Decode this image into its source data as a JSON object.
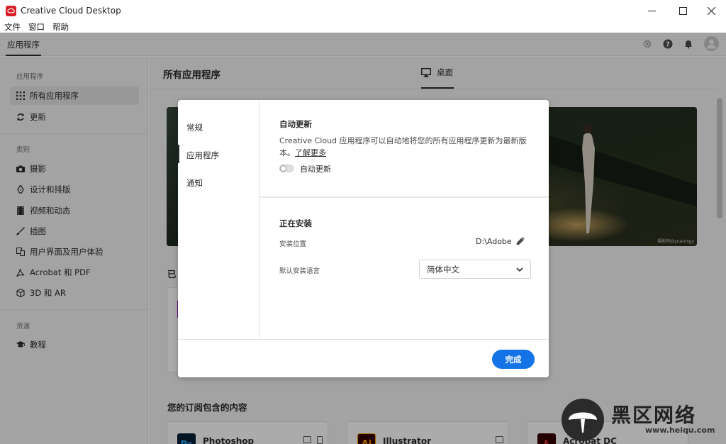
{
  "window": {
    "title": "Creative Cloud Desktop",
    "minimize": "—",
    "maximize": "☐",
    "close": "✕"
  },
  "menu": [
    "文件",
    "窗口",
    "帮助"
  ],
  "appbar": {
    "tab": "应用程序"
  },
  "sidebar": {
    "section_apps": "应用程序",
    "items_apps": [
      {
        "label": "所有应用程序",
        "icon": "grid-icon"
      },
      {
        "label": "更新",
        "icon": "refresh-icon"
      }
    ],
    "section_categories": "类别",
    "items_categories": [
      {
        "label": "摄影",
        "icon": "camera-icon"
      },
      {
        "label": "设计和排版",
        "icon": "pen-icon"
      },
      {
        "label": "视频和动态",
        "icon": "film-icon"
      },
      {
        "label": "插图",
        "icon": "brush-icon"
      },
      {
        "label": "用户界面及用户体验",
        "icon": "layout-icon"
      },
      {
        "label": "Acrobat 和 PDF",
        "icon": "acrobat-icon"
      },
      {
        "label": "3D 和 AR",
        "icon": "cube-icon"
      }
    ],
    "section_resources": "资源",
    "items_resources": [
      {
        "label": "教程",
        "icon": "graduation-cap-icon"
      }
    ]
  },
  "main": {
    "title": "所有应用程序",
    "desktop_tab": "桌面",
    "hero_credit": "摄影师@yuanrsgy",
    "installed_peek": "已",
    "subscription_title": "您的订阅包含的内容",
    "apps": [
      {
        "name": "Photoshop",
        "abbr": "Ps",
        "bg": "#001e36",
        "fg": "#31a8ff"
      },
      {
        "name": "Illustrator",
        "abbr": "Ai",
        "bg": "#330000",
        "fg": "#ff9a00"
      },
      {
        "name": "Acrobat DC",
        "abbr": "",
        "bg": "#3a0000",
        "fg": "#ff4040"
      }
    ]
  },
  "dialog": {
    "nav": [
      "常规",
      "应用程序",
      "通知"
    ],
    "auto_update": {
      "heading": "自动更新",
      "description": "Creative Cloud 应用程序可以自动地将您的所有应用程序更新为最新版本。",
      "learn_more": "了解更多",
      "toggle_label": "自动更新",
      "toggle_on": false
    },
    "installing": {
      "heading": "正在安装",
      "location_label": "安装位置",
      "location_value": "D:\\Adobe",
      "language_label": "默认安装语言",
      "language_value": "简体中文"
    },
    "done_button": "完成"
  },
  "watermark": {
    "text": "黑区网络",
    "url": "www.heiqu.com"
  },
  "colors": {
    "accent": "#1473e6",
    "brand": "#da1f26"
  }
}
